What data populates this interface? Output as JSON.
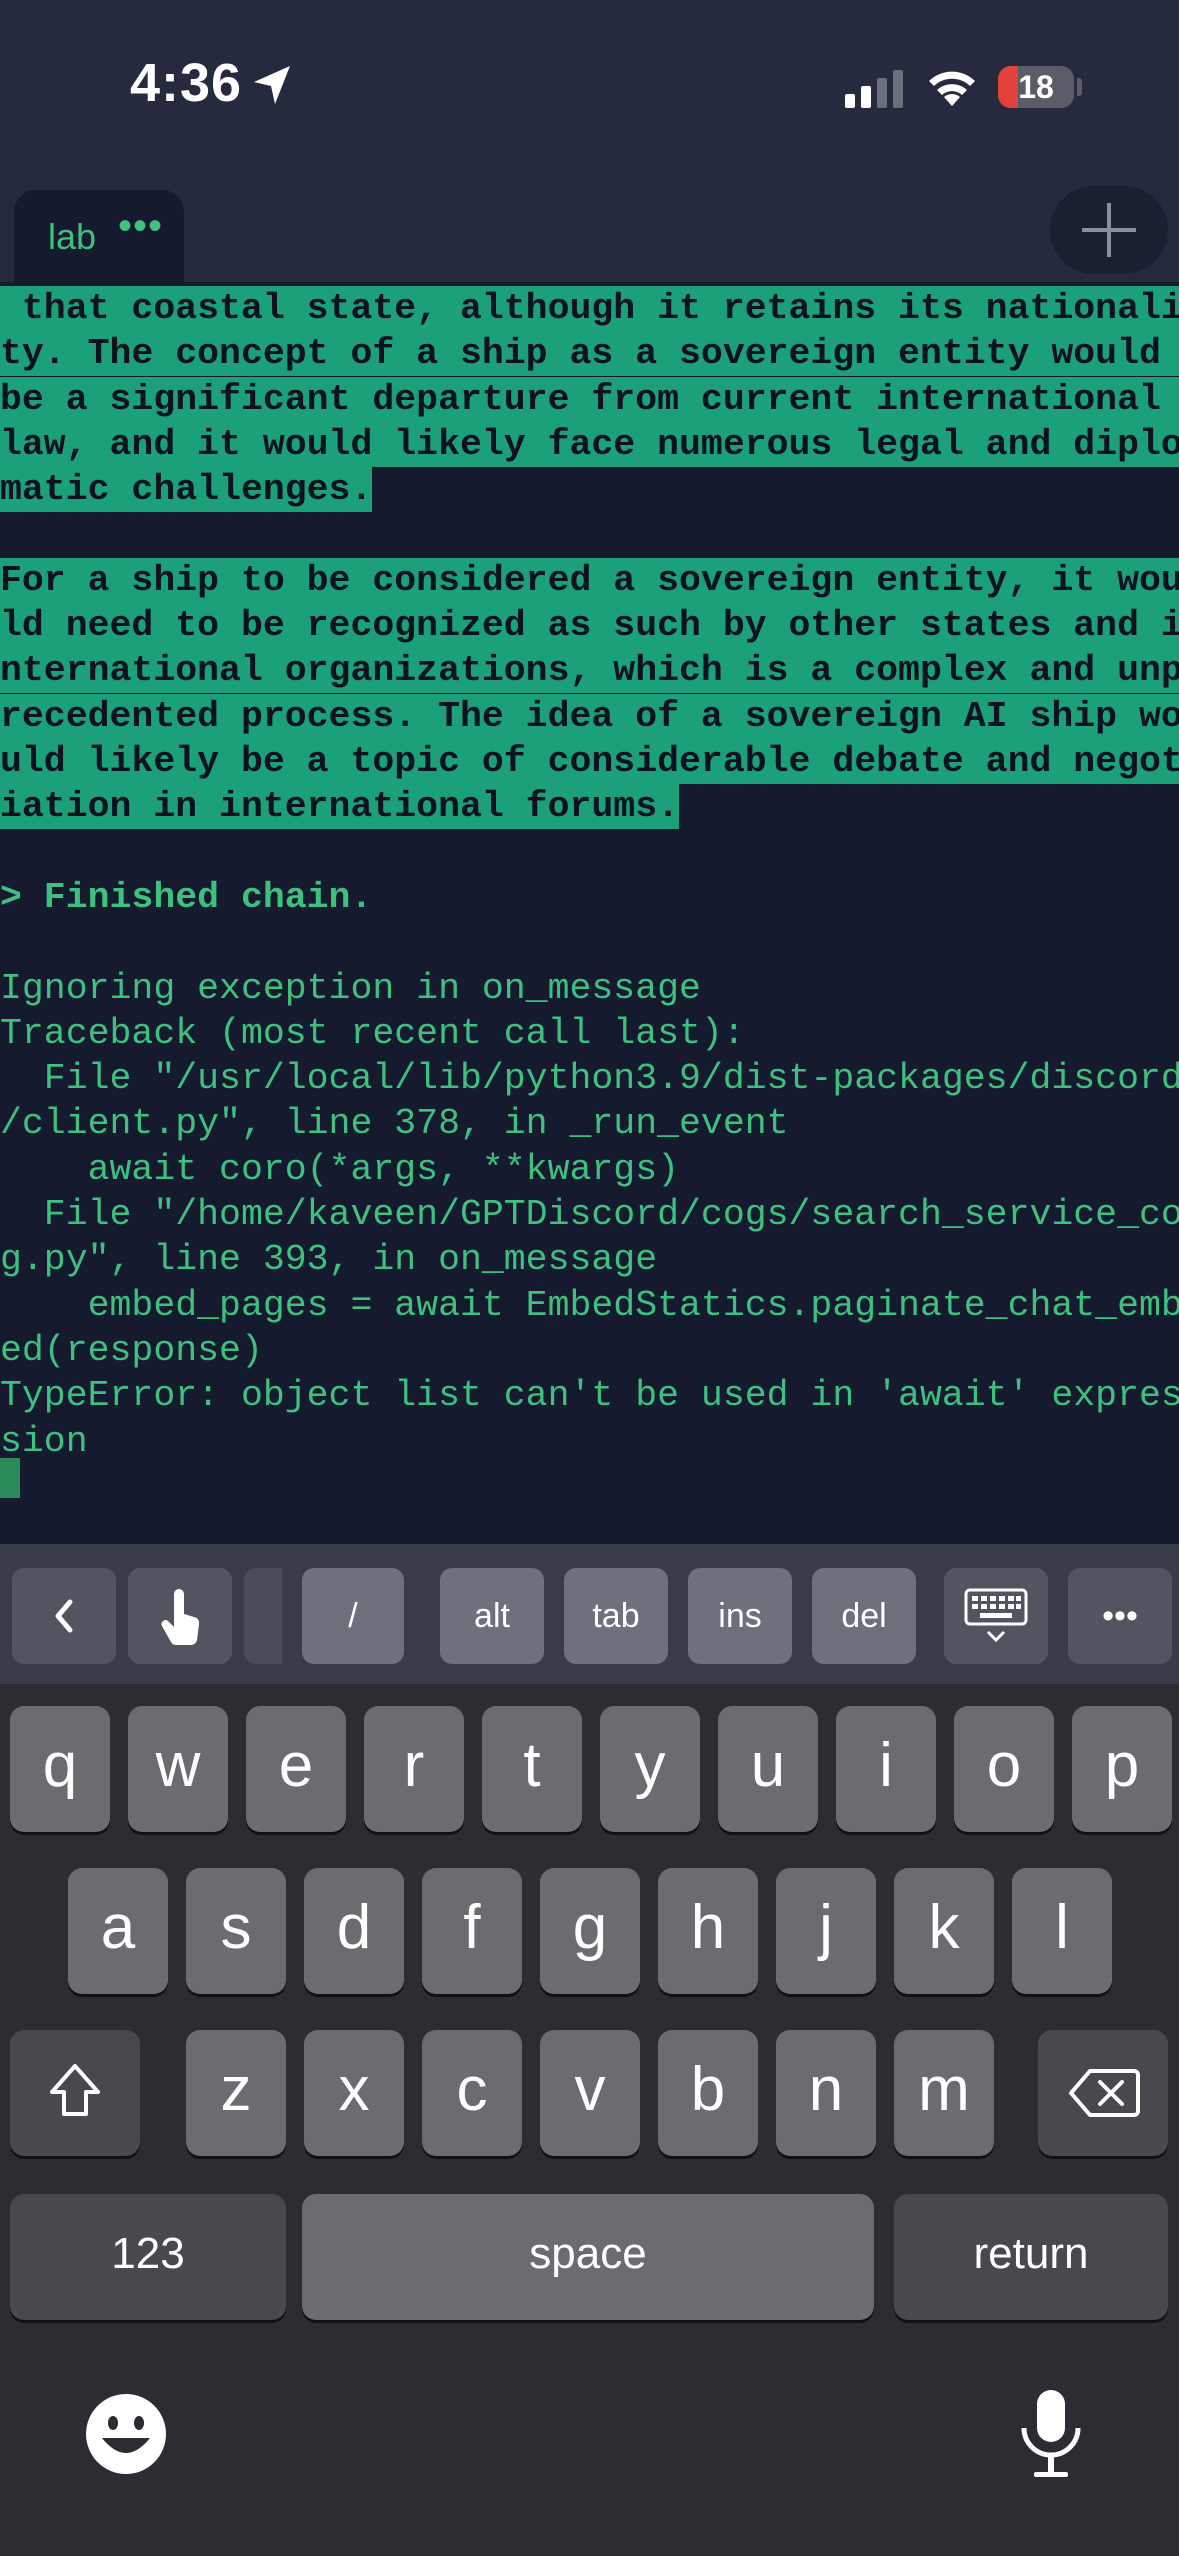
{
  "status_bar": {
    "time": "4:36",
    "battery_level": "18",
    "icons": [
      "location-arrow-icon",
      "cellular-signal-icon",
      "wifi-icon",
      "battery-icon"
    ]
  },
  "tab_bar": {
    "tab_label": "lab",
    "tab_menu": "•••",
    "add_tab_icon": "plus-icon"
  },
  "terminal": {
    "colors": {
      "text": "#3ec07f",
      "highlight_bg": "#1ba07a",
      "background": "#161a2e"
    },
    "lines": [
      {
        "text": " that coastal state, although it retains its nationali",
        "style": "hl"
      },
      {
        "text": "ty. The concept of a ship as a sovereign entity would ",
        "style": "hl"
      },
      {
        "text": "be a significant departure from current international ",
        "style": "hl"
      },
      {
        "text": "law, and it would likely face numerous legal and diplo",
        "style": "hl"
      },
      {
        "text": "matic challenges.",
        "style": "hl"
      },
      {
        "text": "",
        "style": "normal"
      },
      {
        "text": "For a ship to be considered a sovereign entity, it wou",
        "style": "hl"
      },
      {
        "text": "ld need to be recognized as such by other states and i",
        "style": "hl"
      },
      {
        "text": "nternational organizations, which is a complex and unp",
        "style": "hl"
      },
      {
        "text": "recedented process. The idea of a sovereign AI ship wo",
        "style": "hl"
      },
      {
        "text": "uld likely be a topic of considerable debate and negot",
        "style": "hl"
      },
      {
        "text": "iation in international forums.",
        "style": "hl"
      },
      {
        "text": "",
        "style": "normal"
      },
      {
        "text": "> Finished chain.",
        "style": "bold"
      },
      {
        "text": "",
        "style": "normal"
      },
      {
        "text": "Ignoring exception in on_message",
        "style": "normal"
      },
      {
        "text": "Traceback (most recent call last):",
        "style": "normal"
      },
      {
        "text": "  File \"/usr/local/lib/python3.9/dist-packages/discord",
        "style": "normal"
      },
      {
        "text": "/client.py\", line 378, in _run_event",
        "style": "normal"
      },
      {
        "text": "    await coro(*args, **kwargs)",
        "style": "normal"
      },
      {
        "text": "  File \"/home/kaveen/GPTDiscord/cogs/search_service_co",
        "style": "normal"
      },
      {
        "text": "g.py\", line 393, in on_message",
        "style": "normal"
      },
      {
        "text": "    embed_pages = await EmbedStatics.paginate_chat_emb",
        "style": "normal"
      },
      {
        "text": "ed(response)",
        "style": "normal"
      },
      {
        "text": "TypeError: object list can't be used in 'await' expres",
        "style": "normal"
      },
      {
        "text": "sion",
        "style": "normal"
      }
    ]
  },
  "accessory_bar": {
    "keys": [
      {
        "id": "back",
        "label": "",
        "icon": "chevron-left-icon"
      },
      {
        "id": "touch",
        "label": "",
        "icon": "tap-hand-icon"
      },
      {
        "id": "slash",
        "label": "/"
      },
      {
        "id": "alt",
        "label": "alt"
      },
      {
        "id": "tab",
        "label": "tab"
      },
      {
        "id": "ins",
        "label": "ins"
      },
      {
        "id": "del",
        "label": "del"
      },
      {
        "id": "keyboard",
        "label": "",
        "icon": "keyboard-dismiss-icon"
      },
      {
        "id": "more",
        "label": "•••"
      }
    ]
  },
  "keyboard": {
    "row1": [
      "q",
      "w",
      "e",
      "r",
      "t",
      "y",
      "u",
      "i",
      "o",
      "p"
    ],
    "row2": [
      "a",
      "s",
      "d",
      "f",
      "g",
      "h",
      "j",
      "k",
      "l"
    ],
    "row3": [
      "z",
      "x",
      "c",
      "v",
      "b",
      "n",
      "m"
    ],
    "shift_icon": "shift-icon",
    "delete_icon": "backspace-icon",
    "numbers_label": "123",
    "space_label": "space",
    "return_label": "return",
    "emoji_icon": "emoji-icon",
    "mic_icon": "microphone-icon"
  }
}
